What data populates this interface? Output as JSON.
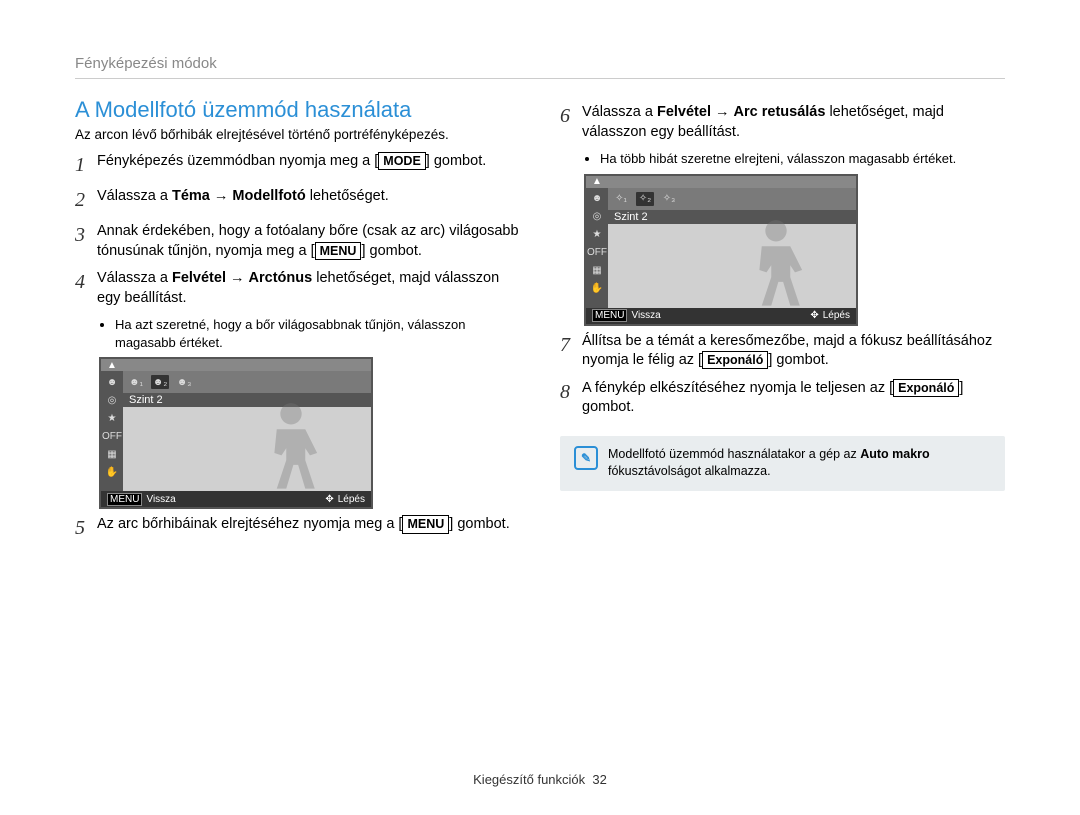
{
  "header": {
    "section": "Fényképezési módok"
  },
  "title": "A Modellfotó üzemmód használata",
  "subtitle": "Az arcon lévő bőrhibák elrejtésével történő portréfényképezés.",
  "steps_left": [
    {
      "num": "1",
      "html": "Fényképezés üzemmódban nyomja meg a [<b>MODE</b>] gombot."
    },
    {
      "num": "2",
      "html": "Válassza a <b>Téma</b> → <b>Modellfotó</b> lehetőséget."
    },
    {
      "num": "3",
      "html": "Annak érdekében, hogy a fotóalany bőre (csak az arc) világosabb tónusúnak tűnjön, nyomja meg a [<b>MENU</b>] gombot."
    },
    {
      "num": "4",
      "html": "Válassza a <b>Felvétel</b> → <b>Arctónus</b> lehetőséget, majd válasszon egy beállítást."
    }
  ],
  "bullets_left": [
    "Ha azt szeretné, hogy a bőr világosabbnak tűnjön, válasszon magasabb értéket."
  ],
  "steps_left2": [
    {
      "num": "5",
      "html": "Az arc bőrhibáinak elrejtéséhez nyomja meg a [<b>MENU</b>] gombot."
    }
  ],
  "steps_right": [
    {
      "num": "6",
      "html": "Válassza a <b>Felvétel</b> → <b>Arc retusálás</b> lehetőséget, majd válasszon egy beállítást."
    }
  ],
  "bullets_right": [
    "Ha több hibát szeretne elrejteni, válasszon magasabb értéket."
  ],
  "steps_right2": [
    {
      "num": "7",
      "html": "Állítsa be a témát a keresőmezőbe, majd a fókusz beállításához nyomja le félig az [<b>Exponáló</b>] gombot."
    },
    {
      "num": "8",
      "html": "A fénykép elkészítéséhez nyomja le teljesen az [<b>Exponáló</b>] gombot."
    }
  ],
  "lcd": {
    "level_label": "Szint 2",
    "back_label": "Vissza",
    "move_label": "Lépés",
    "menu_key": "MENU"
  },
  "info": {
    "text": "Modellfotó üzemmód használatakor a gép az <b>Auto makro</b> fókusztávolságot alkalmazza."
  },
  "footer": {
    "label": "Kiegészítő funkciók",
    "page": "32"
  }
}
